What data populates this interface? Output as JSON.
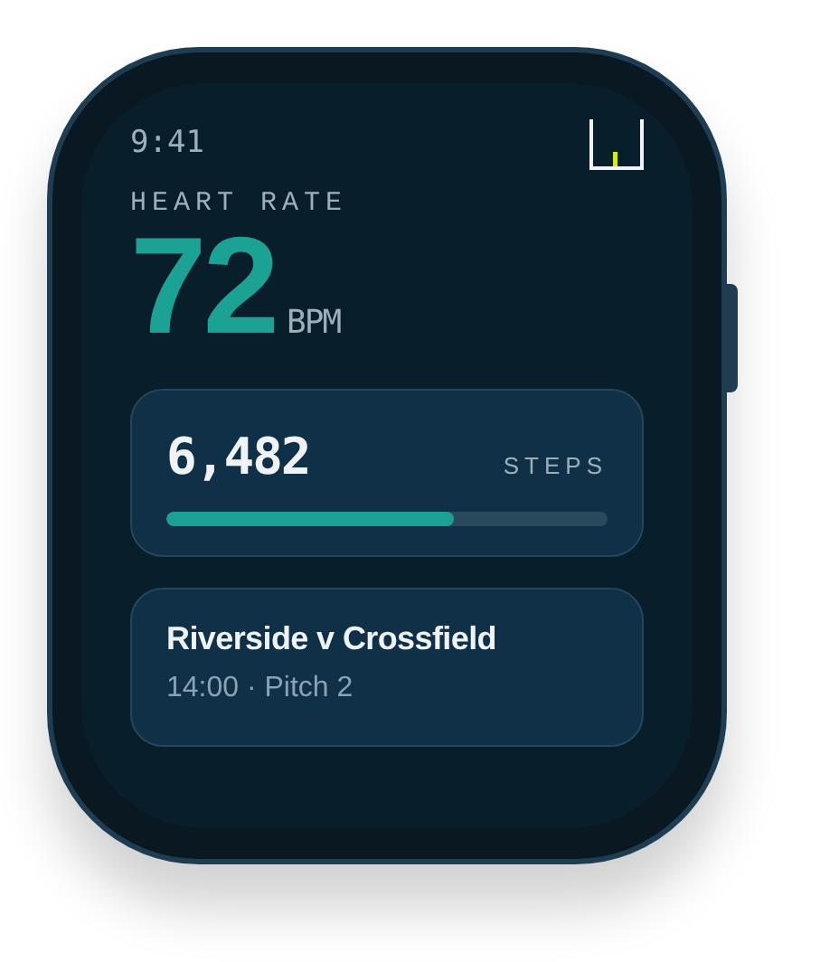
{
  "status_bar": {
    "time": "9:41"
  },
  "heart_rate": {
    "label": "HEART RATE",
    "value": "72",
    "unit": "BPM"
  },
  "steps": {
    "value": "6,482",
    "label": "STEPS",
    "level": 0.65
  },
  "match": {
    "title": "Riverside v Crossfield",
    "details": "14:00 · Pitch 2"
  }
}
